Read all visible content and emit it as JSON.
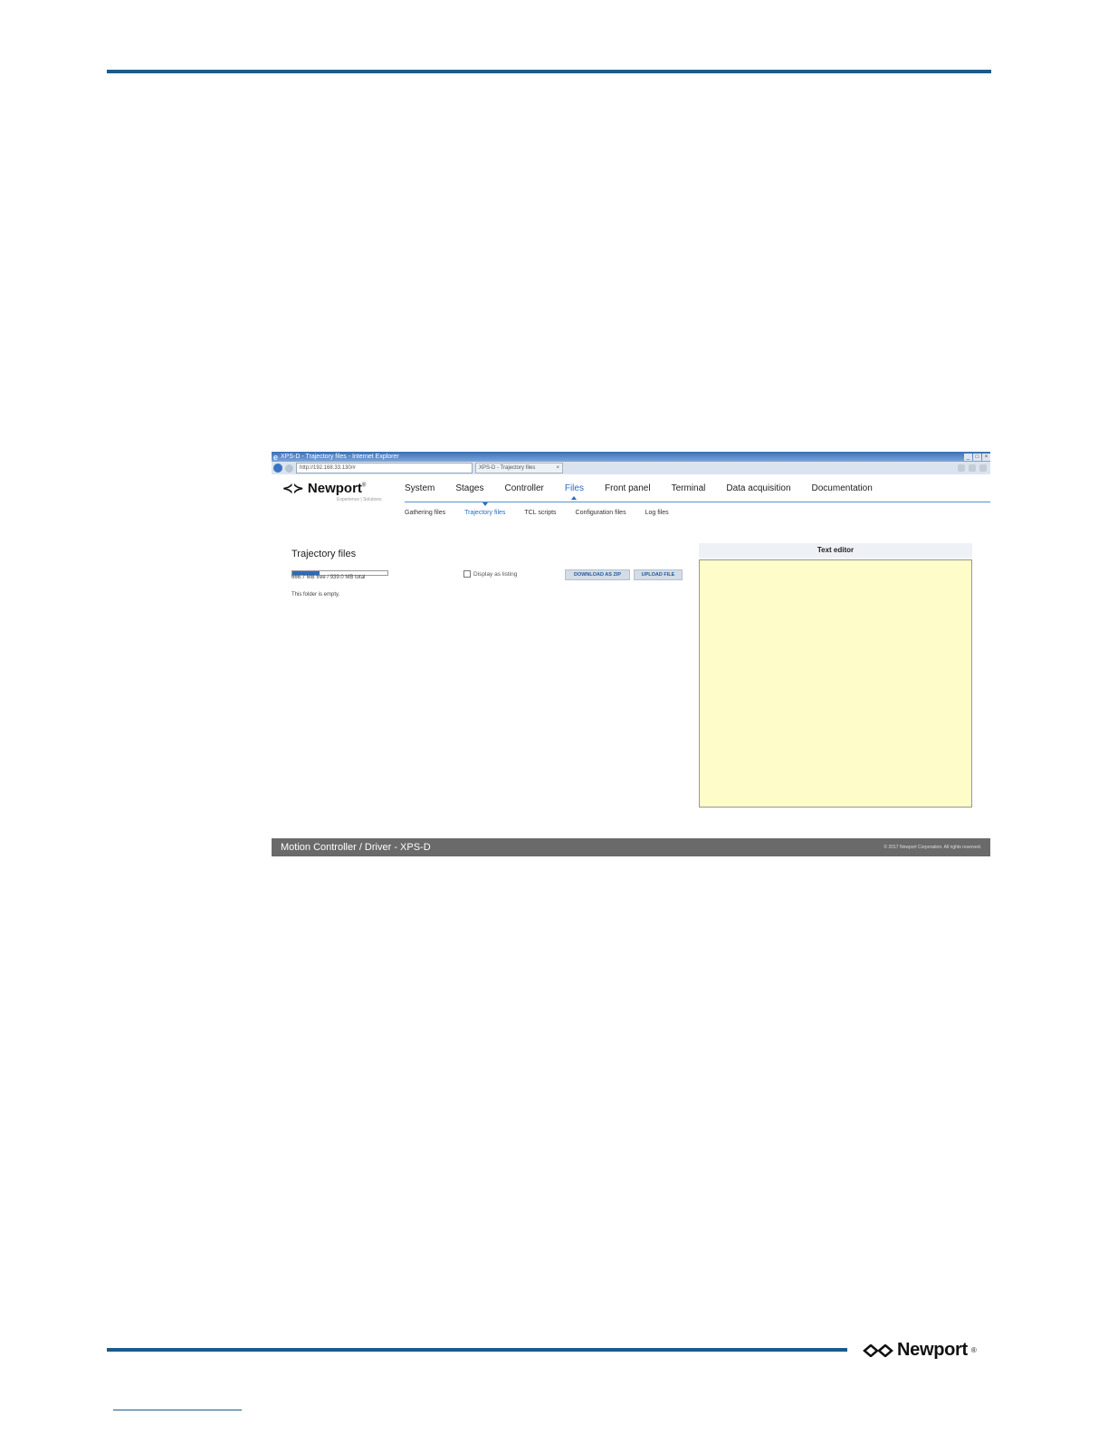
{
  "page": {
    "footer_logo": "Newport",
    "footer_logo_reg": "®"
  },
  "browser": {
    "window_title": "XPS-D - Trajectory files - Internet Explorer",
    "ie_glyph": "e",
    "url": "http://192.168.33.130/#",
    "tab_title": "XPS-D - Trajectory files",
    "tab_close": "×",
    "win_min": "_",
    "win_max": "□",
    "win_close": "×"
  },
  "app": {
    "logo_mark": "≺≻",
    "logo_text": "Newport",
    "logo_reg": "®",
    "logo_tagline": "Experience | Solutions",
    "nav": [
      "System",
      "Stages",
      "Controller",
      "Files",
      "Front panel",
      "Terminal",
      "Data acquisition",
      "Documentation"
    ],
    "nav_active": "Files",
    "subnav": [
      "Gathering files",
      "Trajectory files",
      "TCL scripts",
      "Configuration files",
      "Log files"
    ],
    "subnav_active": "Trajectory files"
  },
  "files": {
    "title": "Trajectory files",
    "disk_usage": "666.7 MB free / 939.0 MB total",
    "used_fraction": 0.29,
    "display_listing_label": "Display as listing",
    "download_zip_label": "DOWNLOAD AS ZIP",
    "upload_label": "UPLOAD FILE",
    "empty_message": "This folder is empty."
  },
  "editor": {
    "title": "Text editor",
    "bg_color": "#fefcc8"
  },
  "footer": {
    "product": "Motion Controller / Driver - XPS-D",
    "copyright": "© 2017 Newport Corporation. All rights reserved."
  },
  "colors": {
    "accent": "#2a6cc4",
    "rule": "#1b5a8a",
    "footer_bar": "#6a6a6a"
  }
}
